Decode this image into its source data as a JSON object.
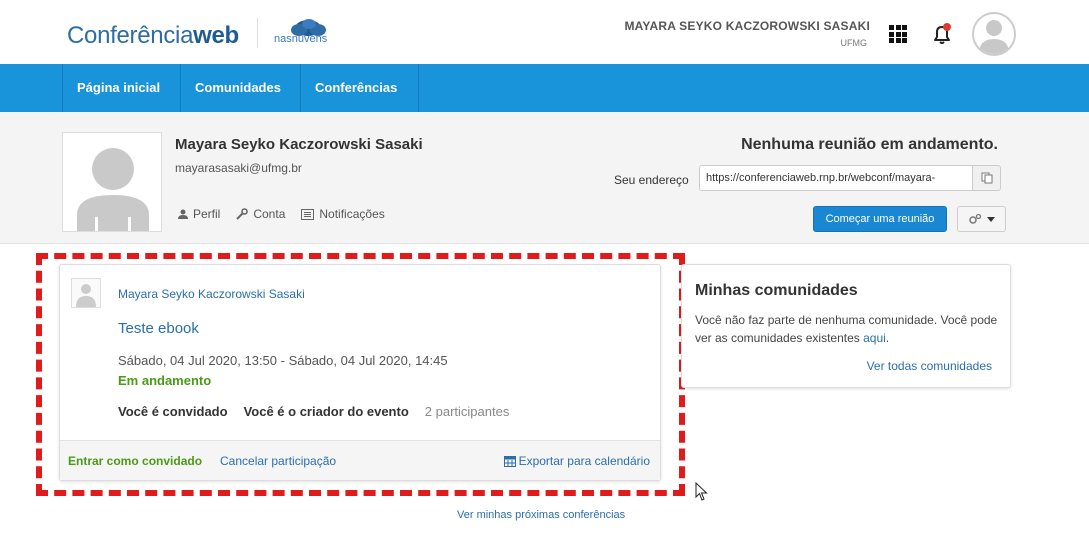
{
  "header": {
    "logo_prefix": "Conferência",
    "logo_bold": "web",
    "partner_logo": "nasnuvens",
    "user_name": "MAYARA SEYKO KACZOROWSKI SASAKI",
    "user_org": "UFMG",
    "icons": [
      "apps-grid-icon",
      "bell-icon",
      "avatar"
    ]
  },
  "nav": {
    "items": [
      {
        "label": "Página inicial"
      },
      {
        "label": "Comunidades"
      },
      {
        "label": "Conferências"
      }
    ]
  },
  "profile": {
    "name": "Mayara Seyko Kaczorowski Sasaki",
    "email": "mayarasasaki@ufmg.br",
    "links": [
      {
        "label": "Perfil",
        "icon": "user-icon"
      },
      {
        "label": "Conta",
        "icon": "wrench-icon"
      },
      {
        "label": "Notificações",
        "icon": "list-icon"
      }
    ]
  },
  "meeting": {
    "status": "Nenhuma reunião em andamento.",
    "address_label": "Seu endereço",
    "address_value": "https://conferenciaweb.rnp.br/webconf/mayara-",
    "start_button": "Começar uma reunião"
  },
  "event": {
    "owner": "Mayara Seyko Kaczorowski Sasaki",
    "title": "Teste ebook",
    "datetime": "Sábado, 04 Jul 2020, 13:50 - Sábado, 04 Jul 2020, 14:45",
    "status": "Em andamento",
    "meta_invited": "Você é convidado",
    "meta_creator": "Você é o criador do evento",
    "meta_participants": "2 participantes",
    "join_label": "Entrar como convidado",
    "cancel_label": "Cancelar participação",
    "export_label": "Exportar para calendário"
  },
  "communities": {
    "title": "Minhas comunidades",
    "text": "Você não faz parte de nenhuma comunidade. Você pode ver as comunidades existentes",
    "link": "aqui",
    "see_all": "Ver todas comunidades"
  },
  "footer": {
    "next_conferences": "Ver minhas próximas conferências"
  },
  "colors": {
    "nav_bg": "#1993da",
    "highlight": "#e01b1b",
    "link": "#2a6eae",
    "success": "#4a9a16"
  }
}
